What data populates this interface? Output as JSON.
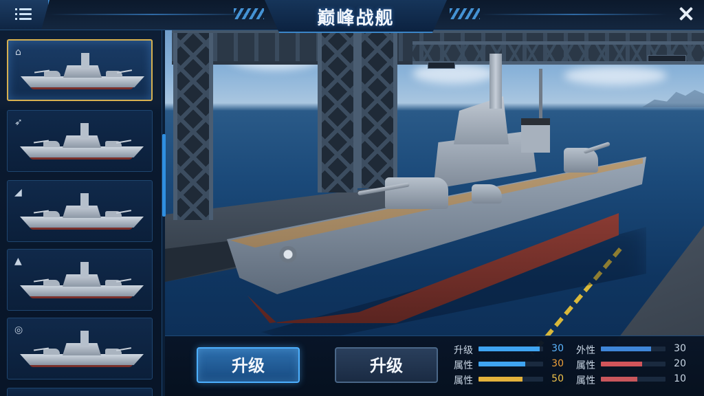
{
  "header": {
    "title": "巅峰战舰"
  },
  "sidebar": {
    "ships": [
      {
        "icon": "factory-icon",
        "selected": true
      },
      {
        "icon": "missile-icon",
        "selected": false
      },
      {
        "icon": "cannon-icon",
        "selected": false
      },
      {
        "icon": "tank-icon",
        "selected": false
      },
      {
        "icon": "shield-icon",
        "selected": false
      },
      {
        "icon": "wave-icon",
        "selected": false
      }
    ]
  },
  "actions": {
    "primary_label": "升级",
    "secondary_label": "升级"
  },
  "stats": {
    "left": [
      {
        "label": "升级",
        "value": "30",
        "fill": 0.95,
        "color": "#3fa4f2",
        "value_color": "#5cb6ff"
      },
      {
        "label": "属性",
        "value": "30",
        "fill": 0.72,
        "color": "#3fa4f2",
        "value_color": "#f0a13a"
      },
      {
        "label": "属性",
        "value": "50",
        "fill": 0.68,
        "color": "#e3b23c",
        "value_color": "#f0c34a"
      }
    ],
    "right": [
      {
        "label": "外性",
        "value": "30",
        "fill": 0.78,
        "color": "#3f86d8",
        "value_color": "#c9d6e4"
      },
      {
        "label": "属性",
        "value": "20",
        "fill": 0.64,
        "color": "#d2555a",
        "value_color": "#c9d6e4"
      },
      {
        "label": "属性",
        "value": "10",
        "fill": 0.56,
        "color": "#c9575c",
        "value_color": "#c9d6e4"
      }
    ]
  },
  "icons": {
    "menu": "menu-list-icon",
    "close": "close-icon"
  }
}
